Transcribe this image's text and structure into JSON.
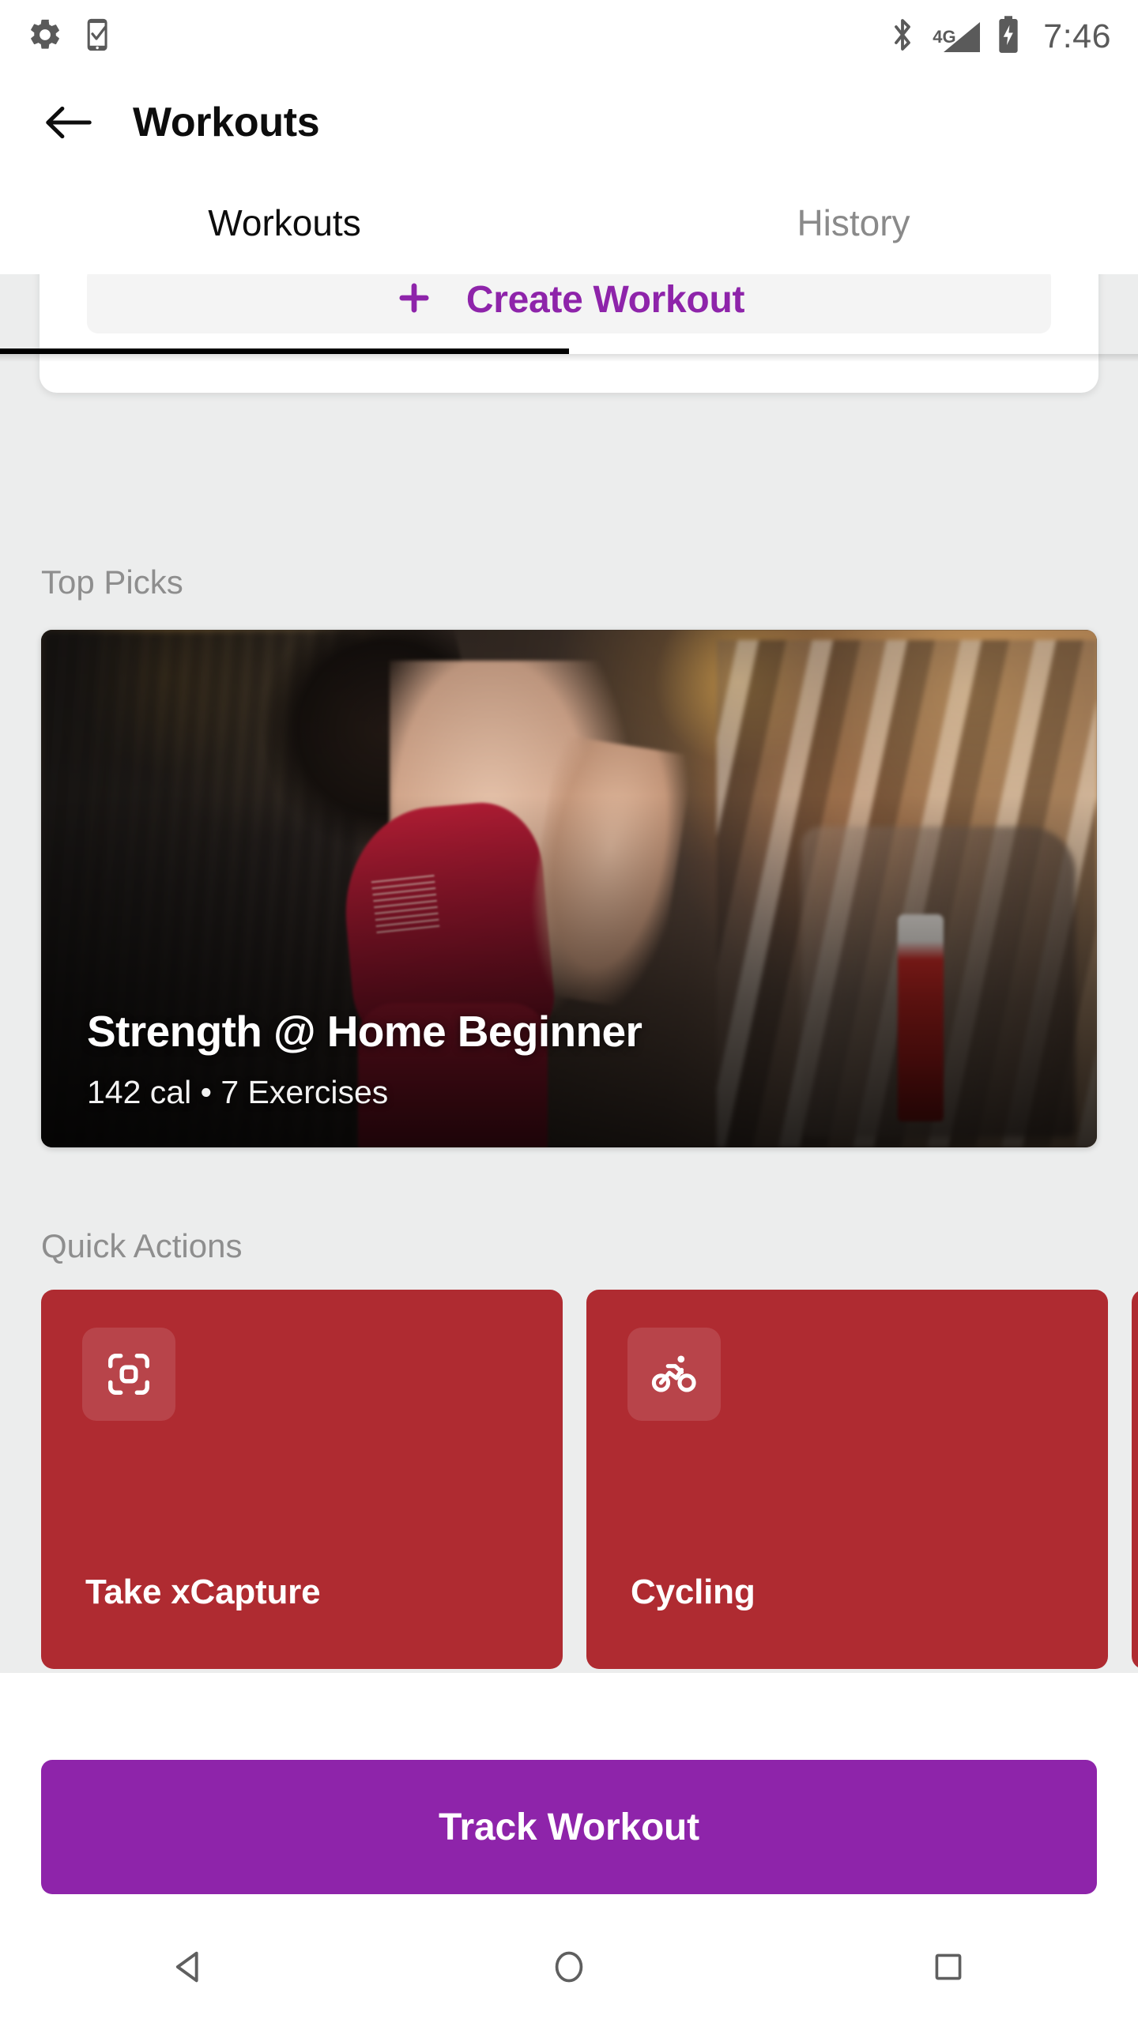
{
  "status_bar": {
    "left_icons": [
      "gear-icon",
      "phone-check-icon"
    ],
    "bluetooth": "bluetooth-icon",
    "network_label": "4G",
    "signal": "signal-triangle-icon",
    "battery": "battery-charging-icon",
    "time": "7:46"
  },
  "app_bar": {
    "back": "back-arrow-icon",
    "title": "Workouts"
  },
  "tabs": [
    {
      "label": "Workouts",
      "active": true
    },
    {
      "label": "History",
      "active": false
    }
  ],
  "create_workout": {
    "icon": "plus-icon",
    "label": "Create Workout"
  },
  "top_picks": {
    "section_title": "Top Picks",
    "featured": {
      "title": "Strength @ Home Beginner",
      "subtitle": "142 cal • 7 Exercises",
      "calories": "142 cal",
      "exercises": "7 Exercises"
    }
  },
  "quick_actions": {
    "section_title": "Quick Actions",
    "cards": [
      {
        "label": "Take xCapture",
        "icon": "scan-capture-icon"
      },
      {
        "label": "Cycling",
        "icon": "cycling-icon"
      },
      {
        "label": "",
        "icon": ""
      }
    ]
  },
  "bottom_bar": {
    "track_label": "Track Workout"
  },
  "nav_bar": {
    "back": "nav-back-triangle-icon",
    "home": "nav-home-circle-icon",
    "recents": "nav-recents-square-icon"
  },
  "colors": {
    "accent_purple": "#8e24aa",
    "card_red": "#af2b31",
    "background": "#eceded",
    "surface": "#ffffff",
    "muted_text": "#8e8e8e",
    "status_icon": "#5a5a5a"
  }
}
